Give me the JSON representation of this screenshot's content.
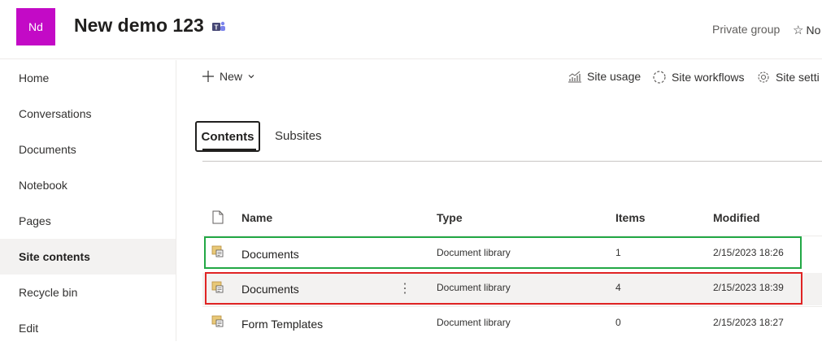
{
  "header": {
    "logo_initials": "Nd",
    "logo_color": "#c30ac6",
    "site_title": "New demo 123",
    "teams_icon": "teams-icon",
    "group_privacy": "Private group",
    "follow_label": "No"
  },
  "nav": {
    "items": [
      {
        "label": "Home"
      },
      {
        "label": "Conversations"
      },
      {
        "label": "Documents"
      },
      {
        "label": "Notebook"
      },
      {
        "label": "Pages"
      },
      {
        "label": "Site contents",
        "selected": true
      },
      {
        "label": "Recycle bin"
      },
      {
        "label": "Edit"
      }
    ]
  },
  "commandbar": {
    "new_label": "New",
    "site_usage": "Site usage",
    "site_workflows": "Site workflows",
    "site_settings": "Site setti"
  },
  "tabs": {
    "contents": "Contents",
    "subsites": "Subsites"
  },
  "table": {
    "columns": {
      "name": "Name",
      "type": "Type",
      "items": "Items",
      "modified": "Modified"
    },
    "rows": [
      {
        "name": "Documents",
        "type": "Document library",
        "items": "1",
        "modified": "2/15/2023 18:26",
        "highlight": "green"
      },
      {
        "name": "Documents",
        "type": "Document library",
        "items": "4",
        "modified": "2/15/2023 18:39",
        "highlight": "red"
      },
      {
        "name": "Form Templates",
        "type": "Document library",
        "items": "0",
        "modified": "2/15/2023 18:27"
      }
    ],
    "more_glyph": "⋮"
  },
  "colors": {
    "highlight_green": "#22a845",
    "highlight_red": "#e02424",
    "library_icon": "#c8a04a"
  }
}
